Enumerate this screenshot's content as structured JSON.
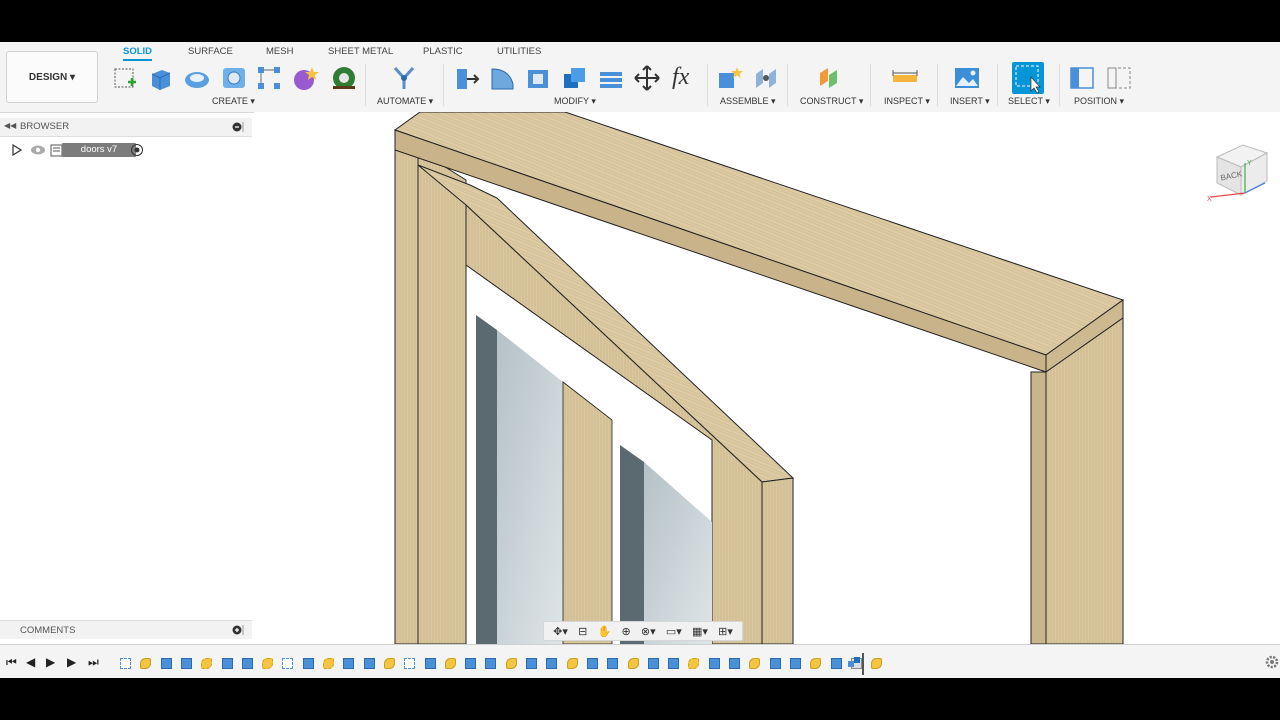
{
  "design_menu": {
    "label": "DESIGN ▾"
  },
  "tabs": [
    {
      "label": "SOLID",
      "active": true
    },
    {
      "label": "SURFACE",
      "active": false
    },
    {
      "label": "MESH",
      "active": false
    },
    {
      "label": "SHEET METAL",
      "active": false
    },
    {
      "label": "PLASTIC",
      "active": false
    },
    {
      "label": "UTILITIES",
      "active": false
    }
  ],
  "groups": {
    "create": "CREATE ▾",
    "automate": "AUTOMATE ▾",
    "modify": "MODIFY ▾",
    "assemble": "ASSEMBLE ▾",
    "construct": "CONSTRUCT ▾",
    "inspect": "INSPECT ▾",
    "insert": "INSERT ▾",
    "select": "SELECT ▾",
    "position": "POSITION ▾"
  },
  "browser": {
    "title": "BROWSER",
    "document": "doors v7"
  },
  "comments": {
    "title": "COMMENTS"
  },
  "modify_fx": "fx",
  "viewcube": {
    "face": "BACK",
    "axis_x": "X",
    "axis_y": "Y"
  },
  "colors": {
    "accent": "#0696d7",
    "wood": "#d8c59c",
    "wood_dark": "#b89f72"
  },
  "icons": {
    "create": [
      "sketch-icon",
      "extrude-icon",
      "revolve-icon",
      "hole-icon",
      "pattern-icon",
      "form-icon",
      "insert-mesh-icon"
    ],
    "timeline": [
      "first-icon",
      "previous-icon",
      "play-icon",
      "next-icon",
      "last-icon"
    ]
  }
}
